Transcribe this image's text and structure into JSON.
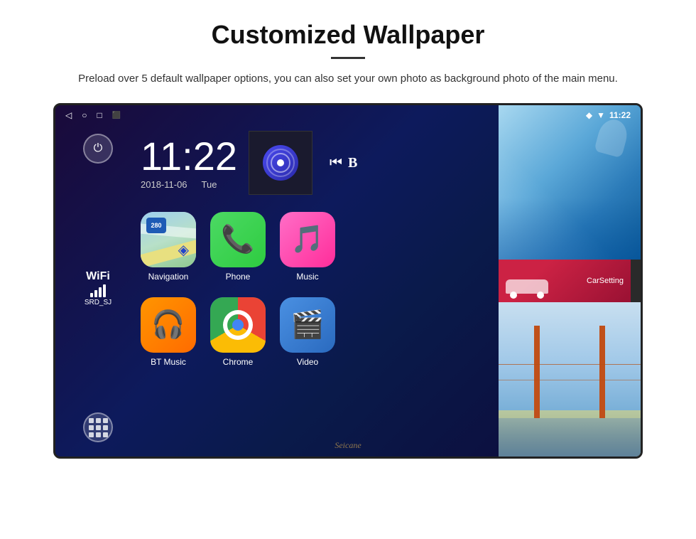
{
  "header": {
    "title": "Customized Wallpaper",
    "description": "Preload over 5 default wallpaper options, you can also set your own photo as background photo of the main menu."
  },
  "status_bar": {
    "time": "11:22",
    "icons": [
      "back-icon",
      "home-icon",
      "recents-icon",
      "screenshot-icon"
    ],
    "right_icons": [
      "location-icon",
      "wifi-icon"
    ]
  },
  "clock": {
    "time": "11:22",
    "date": "2018-11-06",
    "day": "Tue"
  },
  "wifi": {
    "label": "WiFi",
    "ssid": "SRD_SJ"
  },
  "nav_badge": {
    "number": "280",
    "text": "Navigation"
  },
  "apps": [
    {
      "label": "Navigation",
      "icon": "map-icon"
    },
    {
      "label": "Phone",
      "icon": "phone-icon"
    },
    {
      "label": "Music",
      "icon": "music-icon"
    },
    {
      "label": "BT Music",
      "icon": "bluetooth-icon"
    },
    {
      "label": "Chrome",
      "icon": "chrome-icon"
    },
    {
      "label": "Video",
      "icon": "video-icon"
    },
    {
      "label": "CarSetting",
      "icon": "car-icon"
    }
  ],
  "watermark": "Seicane",
  "colors": {
    "accent": "#1e5bb5",
    "bg_start": "#1a0a3a",
    "bg_end": "#0d0a3a"
  }
}
